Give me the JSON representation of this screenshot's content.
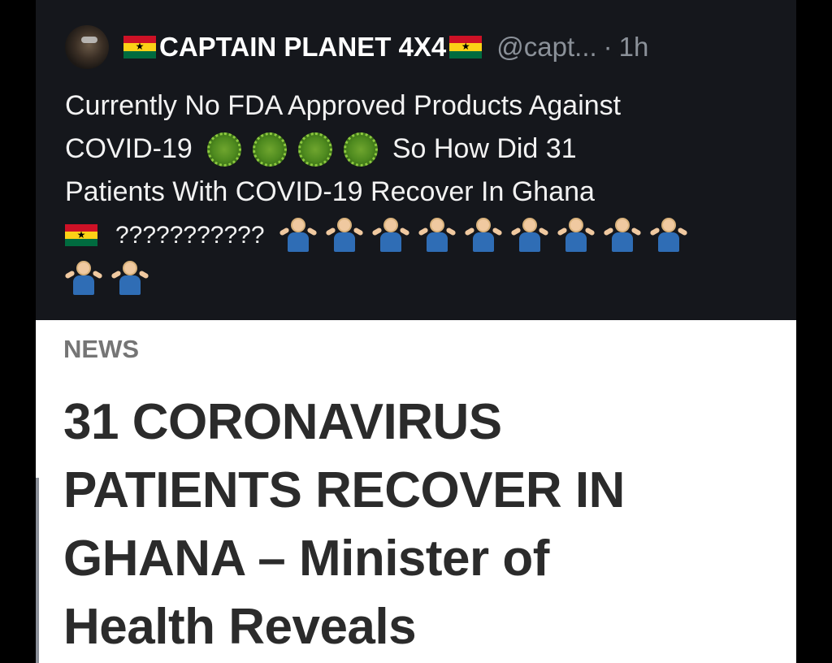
{
  "tweet": {
    "author_name": "CAPTAIN PLANET 4X4",
    "handle": "@capt...",
    "separator": "·",
    "time": "1h",
    "text_line1": "Currently No FDA Approved Products Against",
    "text_line2_start": "COVID-19",
    "text_line2_end": "So How Did 31",
    "text_line3": "Patients With COVID-19 Recover In Ghana",
    "text_line4": "???????????",
    "icons": [
      "ghana-flag-icon",
      "virus-icon",
      "person-shrugging-icon"
    ]
  },
  "article": {
    "section_label": "NEWS",
    "headline_line1": "31 CORONAVIRUS",
    "headline_line2": "PATIENTS RECOVER IN",
    "headline_line3": "GHANA – Minister of",
    "headline_line4": "Health Reveals"
  },
  "colors": {
    "background": "#000000",
    "tweet_bg": "#15171c",
    "handle": "#8b9199",
    "article_bg": "#ffffff",
    "headline": "#2b2b2b"
  }
}
